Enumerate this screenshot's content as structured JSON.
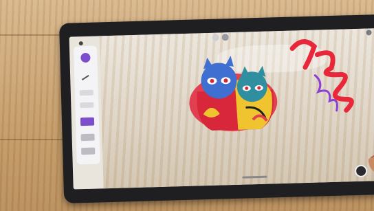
{
  "scene": {
    "description_free": true
  },
  "toolbar": {
    "selected_color": "#7c4dcc",
    "tools": [
      "color-swatch",
      "undo-icon",
      "brush",
      "brush",
      "brush-active",
      "eraser",
      "eraser"
    ]
  },
  "colors": {
    "stroke_red": "#e8283a",
    "stroke_purple": "#8a3fd6",
    "sculpture_red": "#d8263a",
    "sculpture_blue": "#3e6fd1",
    "sculpture_teal": "#2f8fa0",
    "sculpture_yellow": "#f0c42e"
  }
}
